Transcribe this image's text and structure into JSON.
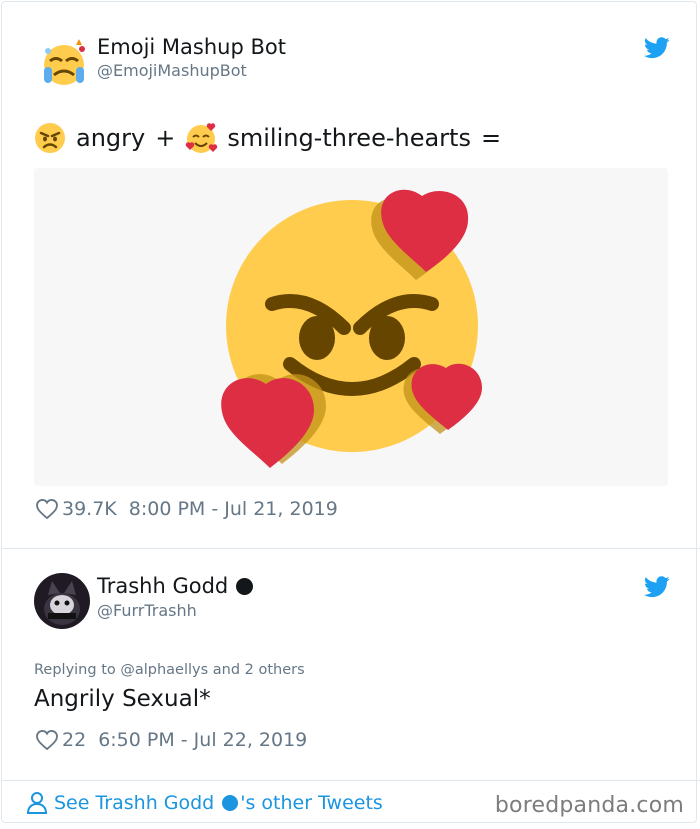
{
  "tweet1": {
    "display_name": "Emoji Mashup Bot",
    "handle": "@EmojiMashupBot",
    "text_part1": "angry",
    "text_plus": "+",
    "text_part2": "smiling-three-hearts",
    "text_equals": "=",
    "likes": "39.7K",
    "time": "8:00 PM - Jul 21, 2019",
    "icons": [
      "avatar-emoji-mashup",
      "angry-emoji-icon",
      "smiling-three-hearts-emoji-icon",
      "heart-icon",
      "twitter-bird-icon"
    ],
    "colors": {
      "emoji_yellow": "#FFCC4D",
      "feature_brown": "#664500",
      "heart_red": "#DD2E44"
    }
  },
  "tweet2": {
    "display_name": "Trashh Godd",
    "handle": "@FurrTrashh",
    "replying_to": "Replying to @alphaellys and 2 others",
    "text": "Angrily Sexual*",
    "likes": "22",
    "time": "6:50 PM - Jul 22, 2019",
    "icons": [
      "avatar-furry",
      "black-circle-icon",
      "heart-icon",
      "twitter-bird-icon"
    ]
  },
  "footer": {
    "see_more_prefix": "See Trashh Godd",
    "see_more_suffix": "'s other Tweets",
    "watermark": "boredpanda.com",
    "icons": [
      "person-icon",
      "blue-circle-icon"
    ]
  },
  "colors": {
    "accent": "#1B95E0",
    "twitter_blue": "#1DA1F2",
    "secondary_text": "#657786",
    "border": "#E1E8ED"
  }
}
